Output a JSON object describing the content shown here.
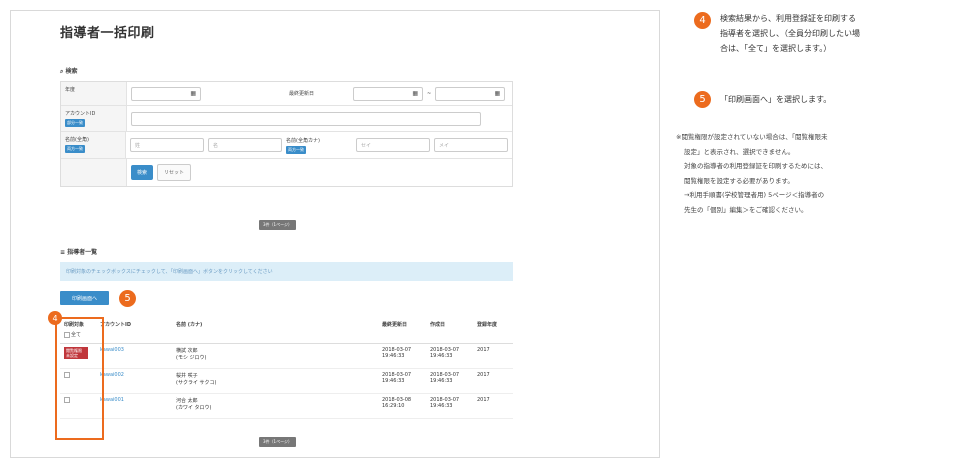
{
  "page_title": "指導者一括印刷",
  "search": {
    "header": "検索",
    "year_label": "年度",
    "updated_label": "最終更新日",
    "tilde": "~",
    "account_label": "アカウントID",
    "partial_badge": "部分一致",
    "name_label": "名前(全角)",
    "name_kana_label": "名前(全角カナ)",
    "both_badge": "両方一致",
    "sei_placeholder": "姓",
    "mei_placeholder": "名",
    "sei_kana_placeholder": "セイ",
    "mei_kana_placeholder": "メイ",
    "search_button": "検索",
    "reset_button": "リセット"
  },
  "pager_text": "3件（1ページ）",
  "list": {
    "header": "指導者一覧",
    "info": "印刷対象のチェックボックスにチェックして、「印刷画面へ」ボタンをクリックしてください",
    "print_button": "印刷画面へ",
    "columns": [
      "印刷対象",
      "アカウントID",
      "名前 (カナ)",
      "最終更新日",
      "作成日",
      "登録年度"
    ],
    "select_all": "全て",
    "rows": [
      {
        "permission": "閲覧権限\n未設定",
        "account": "kawai003",
        "name": "横試 次郎",
        "kana": "(モシ ジロウ)",
        "updated_d": "2018-03-07",
        "updated_t": "19:46:33",
        "created_d": "2018-03-07",
        "created_t": "19:46:33",
        "year": "2017"
      },
      {
        "permission": "",
        "account": "kawai002",
        "name": "桜井 咲子",
        "kana": "(サクライ サクコ)",
        "updated_d": "2018-03-07",
        "updated_t": "19:46:33",
        "created_d": "2018-03-07",
        "created_t": "19:46:33",
        "year": "2017"
      },
      {
        "permission": "",
        "account": "kawai001",
        "name": "河合 太郎",
        "kana": "(カワイ タロウ)",
        "updated_d": "2018-03-08",
        "updated_t": "16:29:10",
        "created_d": "2018-03-07",
        "created_t": "19:46:33",
        "year": "2017"
      }
    ]
  },
  "markers": {
    "four": "4",
    "five": "5"
  },
  "instructions": {
    "step4_lines": [
      "検索結果から、利用登録証を印刷する",
      "指導者を選択し、（全員分印刷したい場",
      "合は、「全て」を選択します。）"
    ],
    "step5": "「印刷画面へ」を選択します。",
    "note_lines": [
      "※閲覧権限が設定されていない場合は、「閲覧権限未",
      "設定」と表示され、選択できません。",
      "対象の指導者の利用登録証を印刷するためには、",
      "閲覧権限を設定する必要があります。",
      "→利用手順書(学校管理者用) 5ページ＜指導者の",
      "先生の「個別」編集＞をご確認ください。"
    ]
  },
  "colors": {
    "accent": "#ec6b1e",
    "primary": "#3a8dc9",
    "danger": "#c0363b"
  }
}
